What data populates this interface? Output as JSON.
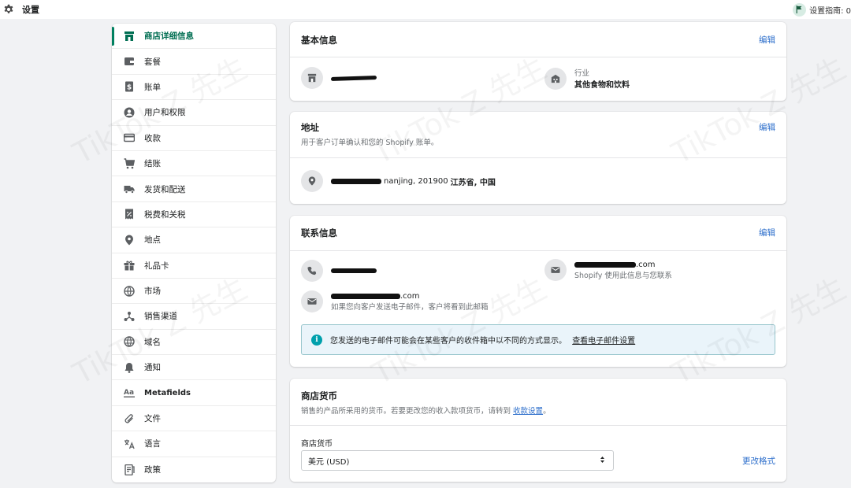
{
  "topbar": {
    "title": "设置",
    "guide_label": "设置指南: 0"
  },
  "sidebar": {
    "items": [
      {
        "label": "商店详细信息",
        "icon": "store-icon",
        "active": true
      },
      {
        "label": "套餐",
        "icon": "wallet-icon"
      },
      {
        "label": "账单",
        "icon": "bill-dollar-icon"
      },
      {
        "label": "用户和权限",
        "icon": "user-circle-icon"
      },
      {
        "label": "收款",
        "icon": "credit-card-icon"
      },
      {
        "label": "结账",
        "icon": "cart-icon"
      },
      {
        "label": "发货和配送",
        "icon": "truck-icon"
      },
      {
        "label": "税费和关税",
        "icon": "receipt-percent-icon"
      },
      {
        "label": "地点",
        "icon": "location-pin-icon"
      },
      {
        "label": "礼品卡",
        "icon": "gift-icon"
      },
      {
        "label": "市场",
        "icon": "globe-market-icon"
      },
      {
        "label": "销售渠道",
        "icon": "channels-icon"
      },
      {
        "label": "域名",
        "icon": "globe-icon"
      },
      {
        "label": "通知",
        "icon": "bell-icon"
      },
      {
        "label": "Metafields",
        "icon": "metafields-icon"
      },
      {
        "label": "文件",
        "icon": "paperclip-icon"
      },
      {
        "label": "语言",
        "icon": "translate-icon"
      },
      {
        "label": "政策",
        "icon": "policy-icon"
      }
    ]
  },
  "basic_info": {
    "title": "基本信息",
    "edit_label": "编辑",
    "industry_label": "行业",
    "industry_value": "其他食物和饮料"
  },
  "address": {
    "title": "地址",
    "subtitle": "用于客户订单确认和您的 Shopify 账单。",
    "edit_label": "编辑",
    "address_text": "nanjing, 201900",
    "region_text": "江苏省, 中国"
  },
  "contact": {
    "title": "联系信息",
    "edit_label": "编辑",
    "email1_suffix": ".com",
    "email1_note": "Shopify 使用此信息与您联系",
    "email2_suffix": ".com",
    "email2_note": "如果您向客户发送电子邮件，客户将看到此邮箱",
    "banner_text": "您发送的电子邮件可能会在某些客户的收件箱中以不同的方式显示。",
    "banner_link": "查看电子邮件设置"
  },
  "currency": {
    "title": "商店货币",
    "subtitle_prefix": "销售的产品所采用的货币。若要更改您的收入款项货币，请转到",
    "subtitle_link": "收款设置",
    "subtitle_suffix": "。",
    "field_label": "商店货币",
    "selected": "美元 (USD)",
    "change_format_label": "更改格式"
  },
  "watermark": "TikTok Z 先生",
  "colors": {
    "accent_green": "#008060",
    "link_blue": "#2c6ecb",
    "banner_bg": "#eaf4fa"
  }
}
